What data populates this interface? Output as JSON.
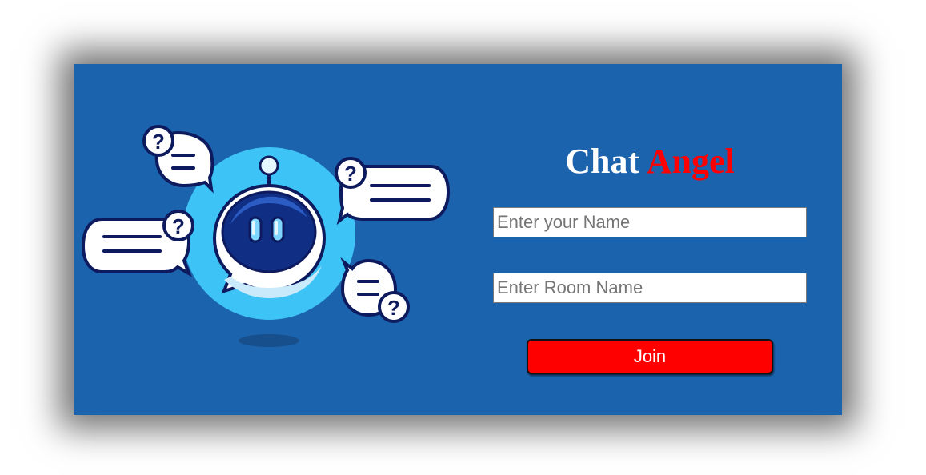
{
  "app": {
    "title_part1": "Chat",
    "title_part2": "Angel"
  },
  "form": {
    "name_placeholder": "Enter your Name",
    "room_placeholder": "Enter Room Name",
    "join_label": "Join"
  },
  "colors": {
    "card_background": "#1c63ae",
    "accent": "#ff0000",
    "robot_halo": "#3dc3f5",
    "robot_face": "#0f2e84",
    "outline": "#0d1a5e"
  },
  "illustration": {
    "icon": "chatbot-icon"
  }
}
